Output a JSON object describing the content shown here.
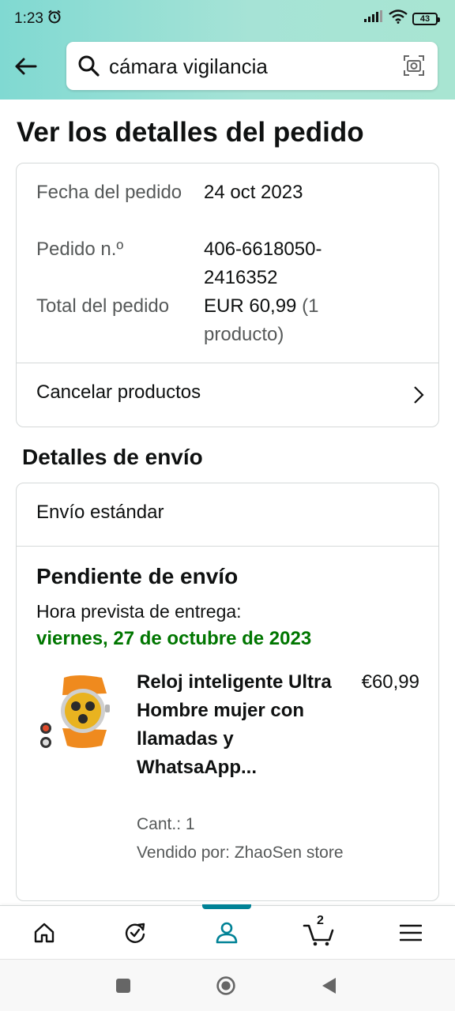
{
  "status_bar": {
    "time": "1:23",
    "battery": "43"
  },
  "search": {
    "query": "cámara vigilancia"
  },
  "page_title": "Ver los detalles del pedido",
  "order": {
    "date_label": "Fecha del pedido",
    "date_value": "24 oct 2023",
    "number_label": "Pedido n.º",
    "number_value": "406-6618050-2416352",
    "total_label": "Total del pedido",
    "total_value": "EUR 60,99",
    "total_count": "(1 producto)",
    "cancel_label": "Cancelar productos"
  },
  "shipping": {
    "section_title": "Detalles de envío",
    "method": "Envío estándar",
    "status": "Pendiente de envío",
    "eta_label": "Hora prevista de entrega:",
    "eta_date": "viernes, 27 de octubre de 2023",
    "product": {
      "title": "Reloj inteligente Ultra Hombre mujer con llamadas y WhatsaApp...",
      "price": "€60,99",
      "quantity": "Cant.: 1",
      "seller": "Vendido por: ZhaoSen store"
    }
  },
  "bottom_nav": {
    "items": [
      "home-icon",
      "refresh-check-icon",
      "account-icon",
      "cart-icon",
      "menu-icon"
    ],
    "cart_count": "2",
    "active": "account-icon",
    "accent": "#008296"
  },
  "colors": {
    "eta": "#007600",
    "muted": "#565959",
    "border": "#d5d9d9"
  }
}
